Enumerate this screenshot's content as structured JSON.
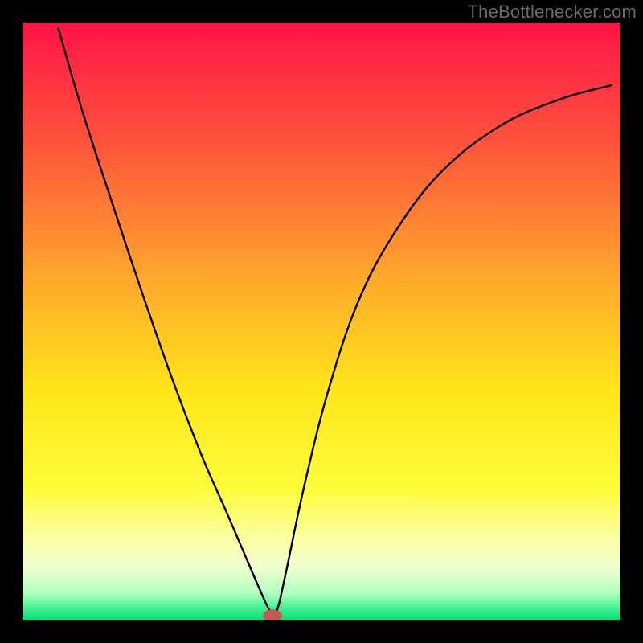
{
  "attribution": "TheBottlenecker.com",
  "chart_data": {
    "type": "line",
    "title": "",
    "xlabel": "",
    "ylabel": "",
    "xlim": [
      0,
      100
    ],
    "ylim": [
      0,
      100
    ],
    "gradient_stops": [
      {
        "offset": 0,
        "color": "#ff1347"
      },
      {
        "offset": 0.22,
        "color": "#ff5a3a"
      },
      {
        "offset": 0.45,
        "color": "#ffb02a"
      },
      {
        "offset": 0.62,
        "color": "#ffe71a"
      },
      {
        "offset": 0.78,
        "color": "#fffc3a"
      },
      {
        "offset": 0.86,
        "color": "#fdffa0"
      },
      {
        "offset": 0.91,
        "color": "#f0ffd0"
      },
      {
        "offset": 0.955,
        "color": "#b0ffc0"
      },
      {
        "offset": 0.98,
        "color": "#40f090"
      },
      {
        "offset": 1.0,
        "color": "#00e070"
      }
    ],
    "series": [
      {
        "name": "bottleneck-curve",
        "x": [
          6,
          10,
          15,
          20,
          25,
          30,
          34,
          37,
          39.5,
          41.4,
          42.5,
          44,
          47,
          51,
          56,
          62,
          70,
          80,
          90,
          98.5
        ],
        "y": [
          99,
          85.2,
          69.8,
          54.8,
          40.5,
          27.5,
          18.4,
          11.4,
          5.6,
          1.6,
          1.6,
          7.8,
          22,
          38,
          53,
          64.5,
          75,
          82.8,
          87.2,
          89.5
        ]
      }
    ],
    "marker": {
      "x": 41.8,
      "y": 0.8,
      "rx": 1.6,
      "ry": 1.05,
      "color": "#c45a55"
    }
  }
}
